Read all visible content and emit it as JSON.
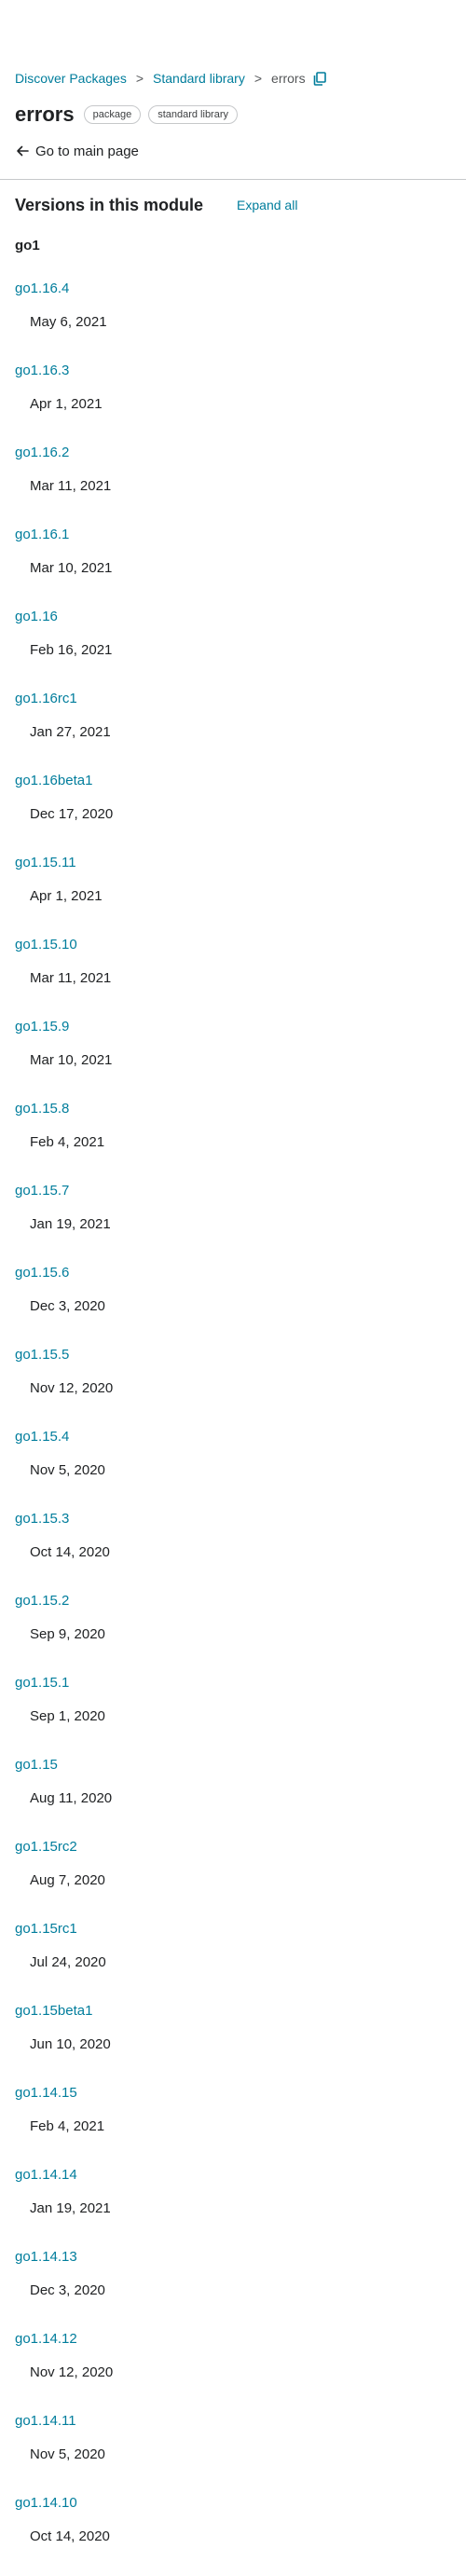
{
  "breadcrumb": {
    "items": [
      {
        "label": "Discover Packages"
      },
      {
        "label": "Standard library"
      }
    ],
    "separator": ">",
    "current": "errors"
  },
  "header": {
    "title": "errors",
    "chips": [
      "package",
      "standard library"
    ],
    "back_link": "Go to main page"
  },
  "versions_section": {
    "title": "Versions in this module",
    "expand_all": "Expand all",
    "major": "go1",
    "items": [
      {
        "version": "go1.16.4",
        "date": "May 6, 2021"
      },
      {
        "version": "go1.16.3",
        "date": "Apr 1, 2021"
      },
      {
        "version": "go1.16.2",
        "date": "Mar 11, 2021"
      },
      {
        "version": "go1.16.1",
        "date": "Mar 10, 2021"
      },
      {
        "version": "go1.16",
        "date": "Feb 16, 2021"
      },
      {
        "version": "go1.16rc1",
        "date": "Jan 27, 2021"
      },
      {
        "version": "go1.16beta1",
        "date": "Dec 17, 2020"
      },
      {
        "version": "go1.15.11",
        "date": "Apr 1, 2021"
      },
      {
        "version": "go1.15.10",
        "date": "Mar 11, 2021"
      },
      {
        "version": "go1.15.9",
        "date": "Mar 10, 2021"
      },
      {
        "version": "go1.15.8",
        "date": "Feb 4, 2021"
      },
      {
        "version": "go1.15.7",
        "date": "Jan 19, 2021"
      },
      {
        "version": "go1.15.6",
        "date": "Dec 3, 2020"
      },
      {
        "version": "go1.15.5",
        "date": "Nov 12, 2020"
      },
      {
        "version": "go1.15.4",
        "date": "Nov 5, 2020"
      },
      {
        "version": "go1.15.3",
        "date": "Oct 14, 2020"
      },
      {
        "version": "go1.15.2",
        "date": "Sep 9, 2020"
      },
      {
        "version": "go1.15.1",
        "date": "Sep 1, 2020"
      },
      {
        "version": "go1.15",
        "date": "Aug 11, 2020"
      },
      {
        "version": "go1.15rc2",
        "date": "Aug 7, 2020"
      },
      {
        "version": "go1.15rc1",
        "date": "Jul 24, 2020"
      },
      {
        "version": "go1.15beta1",
        "date": "Jun 10, 2020"
      },
      {
        "version": "go1.14.15",
        "date": "Feb 4, 2021"
      },
      {
        "version": "go1.14.14",
        "date": "Jan 19, 2021"
      },
      {
        "version": "go1.14.13",
        "date": "Dec 3, 2020"
      },
      {
        "version": "go1.14.12",
        "date": "Nov 12, 2020"
      },
      {
        "version": "go1.14.11",
        "date": "Nov 5, 2020"
      },
      {
        "version": "go1.14.10",
        "date": "Oct 14, 2020"
      }
    ]
  },
  "colors": {
    "link": "#007d9c",
    "text": "#202224",
    "muted": "#555759",
    "border": "#c6c8ca"
  },
  "icons": {
    "copy": "copy-icon",
    "back": "arrow-left-icon"
  }
}
